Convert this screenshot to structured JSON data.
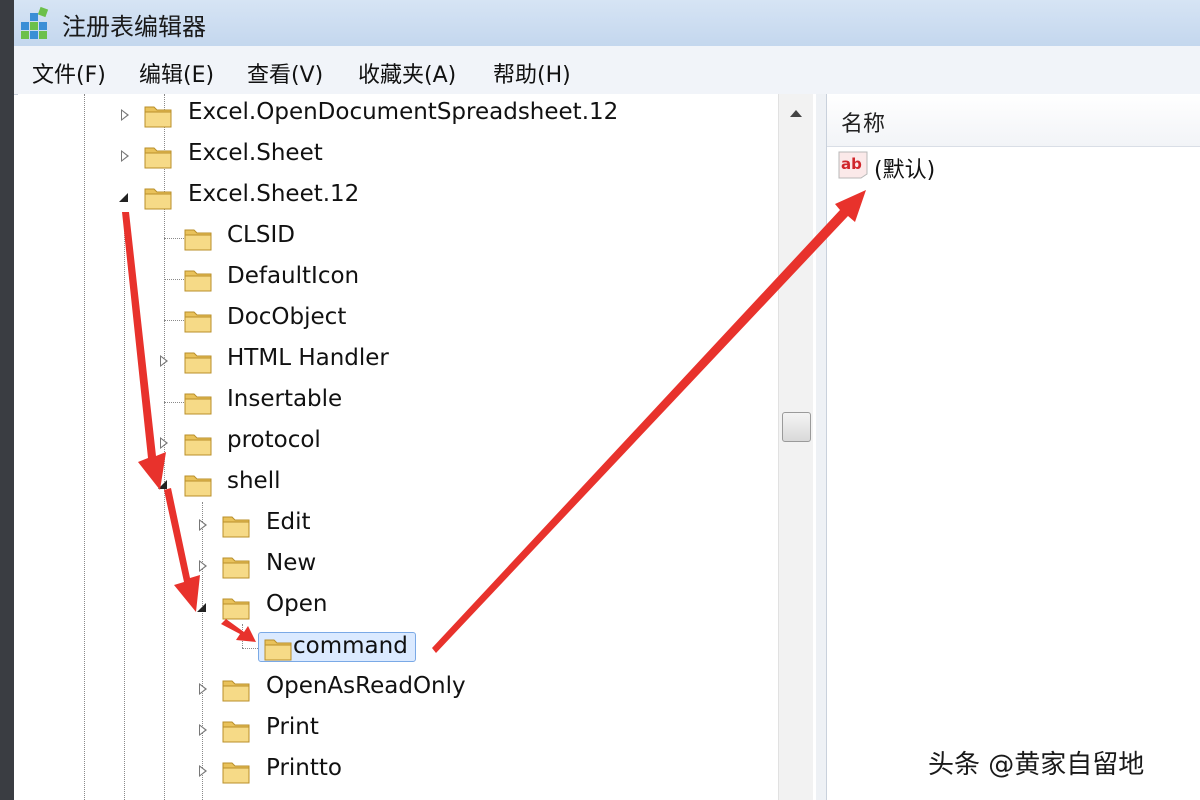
{
  "window": {
    "title": "注册表编辑器",
    "icon": "regedit-icon"
  },
  "menu": [
    "文件(F)",
    "编辑(E)",
    "查看(V)",
    "收藏夹(A)",
    "帮助(H)"
  ],
  "tree": {
    "nodes": [
      {
        "label": "Excel.OpenDocumentSpreadsheet.12",
        "state": "collapsed"
      },
      {
        "label": "Excel.Sheet",
        "state": "collapsed"
      },
      {
        "label": "Excel.Sheet.12",
        "state": "expanded"
      },
      {
        "label": "CLSID",
        "state": "none"
      },
      {
        "label": "DefaultIcon",
        "state": "none"
      },
      {
        "label": "DocObject",
        "state": "none"
      },
      {
        "label": "HTML Handler",
        "state": "collapsed"
      },
      {
        "label": "Insertable",
        "state": "none"
      },
      {
        "label": "protocol",
        "state": "collapsed"
      },
      {
        "label": "shell",
        "state": "expanded"
      },
      {
        "label": "Edit",
        "state": "collapsed"
      },
      {
        "label": "New",
        "state": "collapsed"
      },
      {
        "label": "Open",
        "state": "expanded"
      },
      {
        "label": "command",
        "state": "selected"
      },
      {
        "label": "OpenAsReadOnly",
        "state": "collapsed"
      },
      {
        "label": "Print",
        "state": "collapsed"
      },
      {
        "label": "Printto",
        "state": "collapsed"
      }
    ]
  },
  "values_pane": {
    "column_name": "名称",
    "rows": [
      {
        "name": "(默认)",
        "icon": "string-value-icon"
      }
    ]
  },
  "annotation_color": "#e8322c",
  "watermark": "头条 @黄家自留地"
}
